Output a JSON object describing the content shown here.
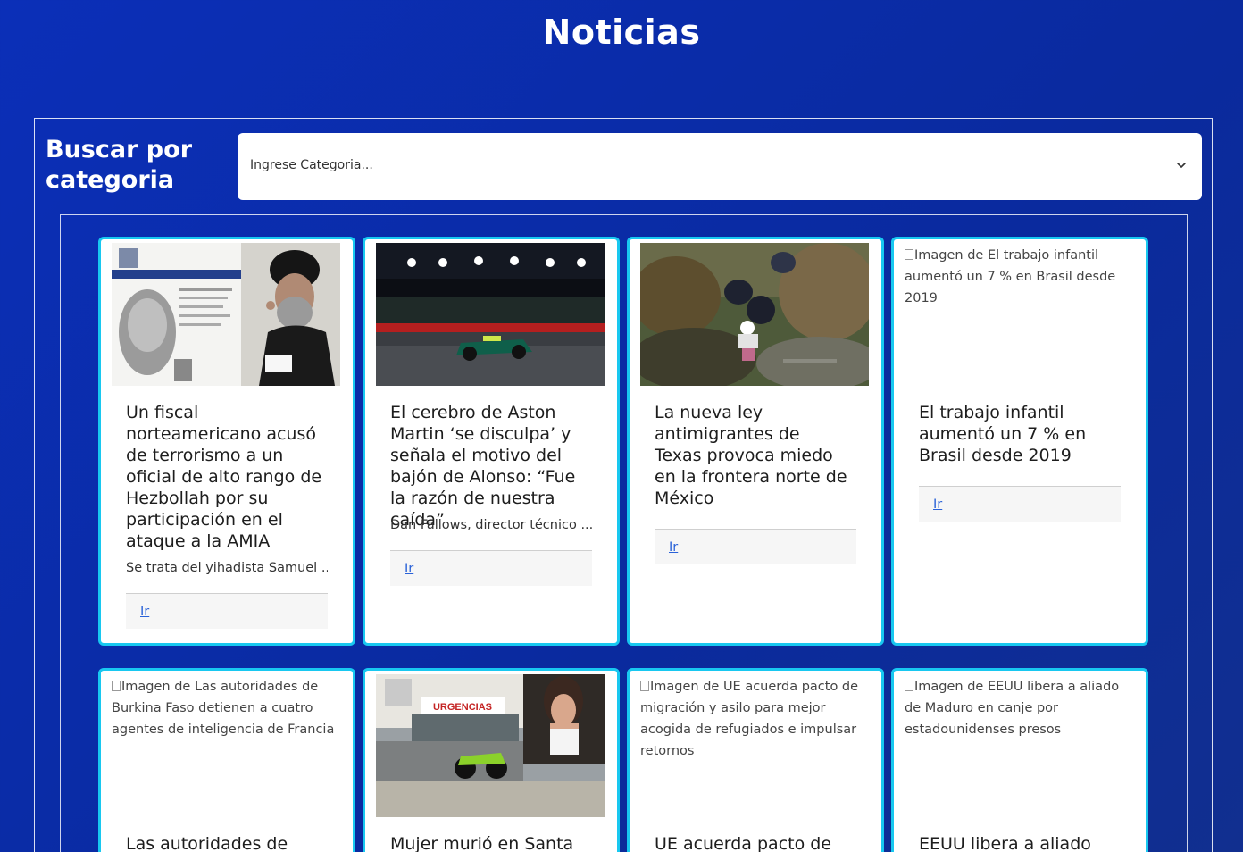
{
  "header": {
    "title": "Noticias"
  },
  "search": {
    "label": "Buscar por categoria",
    "placeholder": "Ingrese Categoria..."
  },
  "cards": [
    {
      "title": "Un fiscal norteamericano acusó de terrorismo a un oficial de alto rango de Hezbollah por su participación en el ataque a la AMIA",
      "text": "Se trata del yihadista Samuel ...",
      "link": "Ir",
      "image": "photo"
    },
    {
      "title": "El cerebro de Aston Martin ‘se disculpa’ y señala el motivo del bajón de Alonso: “Fue la razón de nuestra caída”",
      "text": "Dan Fallows, director técnico ...",
      "link": "Ir",
      "image": "photo"
    },
    {
      "title": "La nueva ley antimigrantes de Texas provoca miedo en la frontera norte de México",
      "text": "",
      "link": "Ir",
      "image": "photo"
    },
    {
      "title": "El trabajo infantil aumentó un 7 % en Brasil desde 2019",
      "text": "",
      "link": "Ir",
      "image_alt": "Imagen de El trabajo infantil aumentó un 7 % en Brasil desde 2019"
    },
    {
      "title": "Las autoridades de",
      "image_alt": "Imagen de Las autoridades de Burkina Faso detienen a cuatro agentes de inteligencia de Francia"
    },
    {
      "title": "Mujer murió en Santa",
      "image": "photo"
    },
    {
      "title": "UE acuerda pacto de",
      "image_alt": "Imagen de UE acuerda pacto de migración y asilo para mejor acogida de refugiados e impulsar retornos"
    },
    {
      "title": "EEUU libera a aliado de",
      "image_alt": "Imagen de EEUU libera a aliado de Maduro en canje por estadounidenses presos"
    }
  ],
  "colors": {
    "background": "#0b2fb8",
    "card_border": "#18c8f0",
    "link": "#2a62d8"
  }
}
